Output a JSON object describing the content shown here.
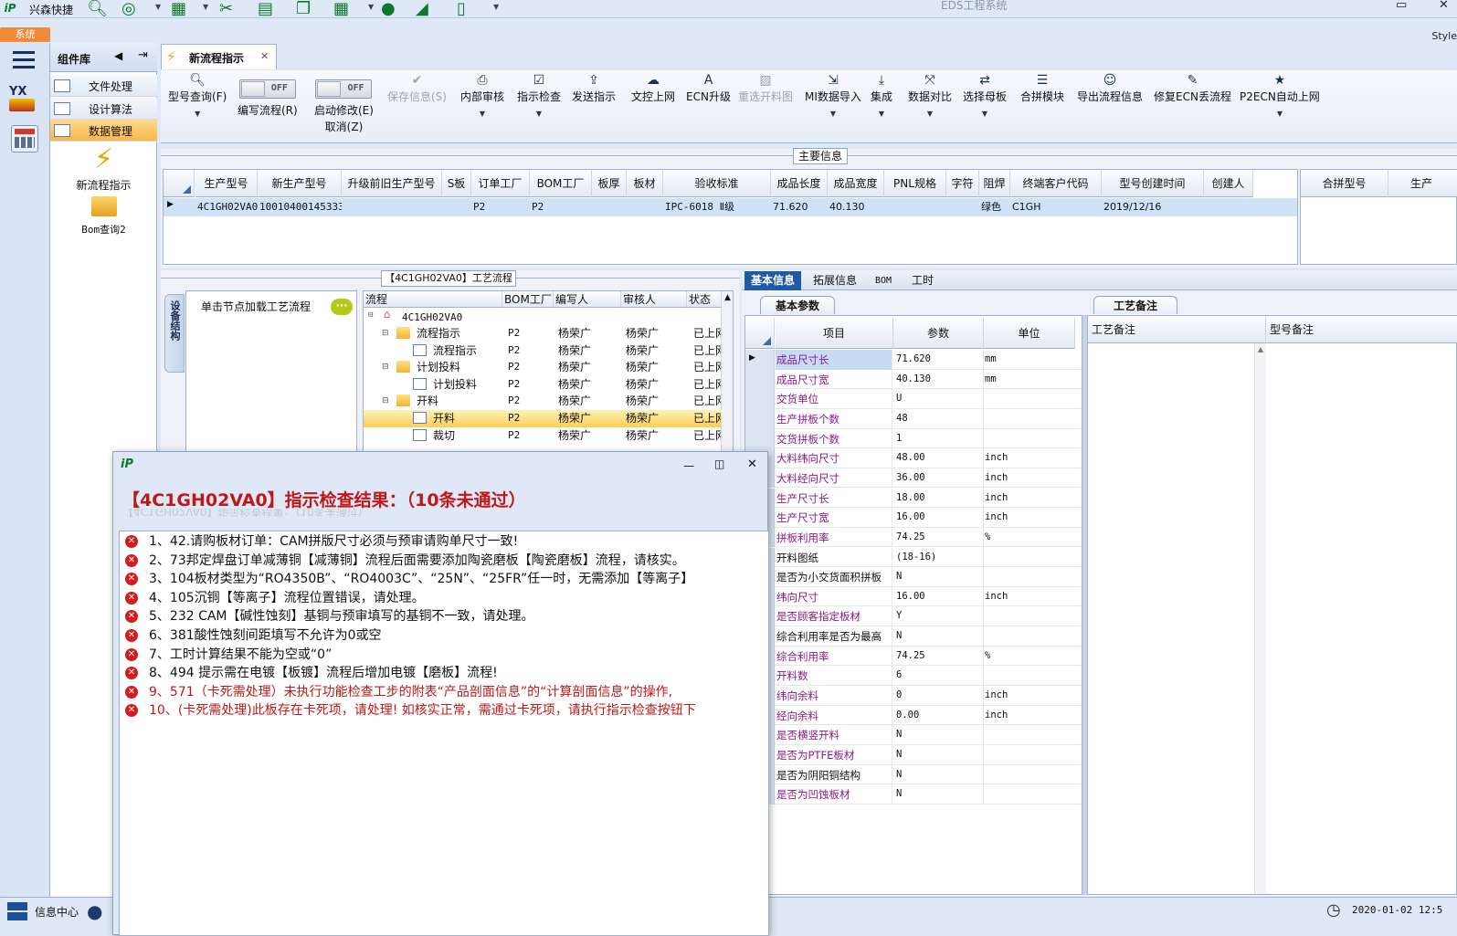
{
  "app": {
    "logo_text": "iP",
    "name": "兴森快捷",
    "title": "EDS工程系统",
    "minimize": "▭",
    "close": "✕",
    "system_tab": "系统",
    "style_label": "Style"
  },
  "quick_toolbar": [
    "search-icon",
    "lifebuoy-icon",
    "table-icon",
    "scissors-icon",
    "film-icon",
    "copy-icon",
    "grid-icon",
    "user-icon",
    "chart-icon",
    "tablet-icon"
  ],
  "component_library": {
    "title": "组件库",
    "items": [
      "文件处理",
      "设计算法",
      "数据管理"
    ],
    "selected": 2,
    "launchers": [
      "新流程指示",
      "Bom查询2"
    ]
  },
  "doc_tab": {
    "label": "新流程指示"
  },
  "ribbon": {
    "buttons": [
      {
        "label": "型号查询(F)",
        "icon": "search-icon",
        "dd": true
      },
      {
        "label": "编写流程(R)",
        "toggle": "OFF"
      },
      {
        "label": "启动修改(E)",
        "label2": "取消(Z)",
        "toggle": "OFF"
      },
      {
        "label": "保存信息(S)",
        "icon": "check-icon",
        "disabled": true
      },
      {
        "label": "内部审核",
        "icon": "print-icon",
        "dd": true
      },
      {
        "label": "指示检查",
        "icon": "checkbox-icon",
        "dd": true
      },
      {
        "label": "发送指示",
        "icon": "upload-icon"
      },
      {
        "label": "文控上网",
        "icon": "cloud-icon"
      },
      {
        "label": "ECN升级",
        "icon": "font-icon"
      },
      {
        "label": "重选开料图",
        "icon": "image-icon",
        "disabled": true
      },
      {
        "label": "MI数据导入",
        "icon": "import-icon",
        "dd": true
      },
      {
        "label": "集成",
        "icon": "download-icon",
        "dd": true
      },
      {
        "label": "数据对比",
        "icon": "compare-icon",
        "dd": true
      },
      {
        "label": "选择母板",
        "icon": "shuffle-icon",
        "dd": true
      },
      {
        "label": "合拼模块",
        "icon": "list-icon"
      },
      {
        "label": "导出流程信息",
        "icon": "smile-icon"
      },
      {
        "label": "修复ECN丢流程",
        "icon": "wrench-icon"
      },
      {
        "label": "P2ECN自动上网",
        "icon": "star-icon",
        "dd": true
      }
    ]
  },
  "main_info": {
    "title": "主要信息",
    "columns": [
      "生产型号",
      "新生产型号",
      "升级前旧生产型号",
      "S板",
      "订单工厂",
      "BOM工厂",
      "板厚",
      "板材",
      "验收标准",
      "成品长度",
      "成品宽度",
      "PNL规格",
      "字符",
      "阻焊",
      "终端客户代码",
      "型号创建时间",
      "创建人"
    ],
    "row": [
      "4C1GH02VA0",
      "10010400145333",
      "",
      "",
      "P2",
      "P2",
      "",
      "",
      "IPC-6018 Ⅱ级",
      "71.620",
      "40.130",
      "",
      "",
      "绿色",
      "C1GH",
      "2019/12/16",
      ""
    ],
    "right_columns": [
      "合拼型号",
      "生产"
    ]
  },
  "flow": {
    "title": "【4C1GH02VA0】工艺流程",
    "vtab": "设备结构",
    "load_hint": "单击节点加载工艺流程",
    "columns": [
      "流程",
      "BOM工厂",
      "编写人",
      "审核人",
      "状态"
    ],
    "root": "4C1GH02VA0",
    "rows": [
      {
        "name": "流程指示",
        "level": 1,
        "folder": true,
        "bom": "P2",
        "writer": "杨荣广",
        "reviewer": "杨荣广",
        "status": "已上网"
      },
      {
        "name": "流程指示",
        "level": 2,
        "folder": false,
        "bom": "P2",
        "writer": "杨荣广",
        "reviewer": "杨荣广",
        "status": "已上网"
      },
      {
        "name": "计划投料",
        "level": 1,
        "folder": true,
        "bom": "P2",
        "writer": "杨荣广",
        "reviewer": "杨荣广",
        "status": "已上网"
      },
      {
        "name": "计划投料",
        "level": 2,
        "folder": false,
        "bom": "P2",
        "writer": "杨荣广",
        "reviewer": "杨荣广",
        "status": "已上网"
      },
      {
        "name": "开料",
        "level": 1,
        "folder": true,
        "bom": "P2",
        "writer": "杨荣广",
        "reviewer": "杨荣广",
        "status": "已上网"
      },
      {
        "name": "开料",
        "level": 2,
        "folder": false,
        "bom": "P2",
        "writer": "杨荣广",
        "reviewer": "杨荣广",
        "status": "已上网",
        "selected": true
      },
      {
        "name": "裁切",
        "level": 2,
        "folder": false,
        "bom": "P2",
        "writer": "杨荣广",
        "reviewer": "杨荣广",
        "status": "已上网"
      }
    ]
  },
  "right_tabs": [
    "基本信息",
    "拓展信息",
    "BOM",
    "工时"
  ],
  "basic_params": {
    "tab": "基本参数",
    "columns": [
      "项目",
      "参数",
      "单位"
    ],
    "rows": [
      {
        "k": "成品尺寸长",
        "v": "71.620",
        "u": "mm",
        "c": "p"
      },
      {
        "k": "成品尺寸宽",
        "v": "40.130",
        "u": "mm",
        "c": "p"
      },
      {
        "k": "交货单位",
        "v": "U",
        "u": "",
        "c": "p"
      },
      {
        "k": "生产拼板个数",
        "v": "48",
        "u": "",
        "c": "p"
      },
      {
        "k": "交货拼板个数",
        "v": "1",
        "u": "",
        "c": "p"
      },
      {
        "k": "大料纬向尺寸",
        "v": "48.00",
        "u": "inch",
        "c": "p"
      },
      {
        "k": "大料经向尺寸",
        "v": "36.00",
        "u": "inch",
        "c": "p"
      },
      {
        "k": "生产尺寸长",
        "v": "18.00",
        "u": "inch",
        "c": "p"
      },
      {
        "k": "生产尺寸宽",
        "v": "16.00",
        "u": "inch",
        "c": "p"
      },
      {
        "k": "拼板利用率",
        "v": "74.25",
        "u": "%",
        "c": "p"
      },
      {
        "k": "开料图纸",
        "v": "(18-16)",
        "u": "",
        "c": "b"
      },
      {
        "k": "是否为小交货面积拼板",
        "v": "N",
        "u": "",
        "c": "b"
      },
      {
        "k": "纬向尺寸",
        "v": "16.00",
        "u": "inch",
        "c": "p"
      },
      {
        "k": "是否顾客指定板材",
        "v": "Y",
        "u": "",
        "c": "p"
      },
      {
        "k": "综合利用率是否为最高",
        "v": "N",
        "u": "",
        "c": "b"
      },
      {
        "k": "综合利用率",
        "v": "74.25",
        "u": "%",
        "c": "p"
      },
      {
        "k": "开料数",
        "v": "6",
        "u": "",
        "c": "p"
      },
      {
        "k": "纬向余料",
        "v": "0",
        "u": "inch",
        "c": "p"
      },
      {
        "k": "经向余料",
        "v": "0.00",
        "u": "inch",
        "c": "p"
      },
      {
        "k": "是否横竖开料",
        "v": "N",
        "u": "",
        "c": "p"
      },
      {
        "k": "是否为PTFE板材",
        "v": "N",
        "u": "",
        "c": "p"
      },
      {
        "k": "是否为阴阳铜结构",
        "v": "N",
        "u": "",
        "c": "b"
      },
      {
        "k": "是否为凹蚀板材",
        "v": "N",
        "u": "",
        "c": "p"
      }
    ]
  },
  "craft": {
    "tab": "工艺备注",
    "columns": [
      "工艺备注",
      "型号备注"
    ]
  },
  "dialog": {
    "logo": "iP",
    "title": "【4C1GH02VA0】指示检查结果：（10条未通过）",
    "ghost": "【4C1GH02VA0】指示检查结果：（10条未通过）",
    "items": [
      {
        "t": "1、42.请购板材订单：CAM拼版尺寸必须与预审请购单尺寸一致!",
        "red": false
      },
      {
        "t": "2、73邦定焊盘订单减薄铜【减薄铜】流程后面需要添加陶瓷磨板【陶瓷磨板】流程，请核实。",
        "red": false
      },
      {
        "t": "3、104板材类型为“RO4350B”、“RO4003C”、“25N”、“25FR”任一时，无需添加【等离子】",
        "red": false
      },
      {
        "t": "4、105沉铜【等离子】流程位置错误，请处理。",
        "red": false
      },
      {
        "t": "5、232 CAM【碱性蚀刻】基铜与预审填写的基铜不一致，请处理。",
        "red": false
      },
      {
        "t": "6、381酸性蚀刻间距填写不允许为0或空",
        "red": false
      },
      {
        "t": "7、工时计算结果不能为空或“0”",
        "red": false
      },
      {
        "t": "8、494 提示需在电镀【板镀】流程后增加电镀【磨板】流程!",
        "red": false
      },
      {
        "t": "9、571（卡死需处理）未执行功能检查工步的附表“产品剖面信息”的“计算剖面信息”的操作,",
        "red": true
      },
      {
        "t": "10、(卡死需处理)此板存在卡死项，请处理! 如核实正常，需通过卡死项，请执行指示检查按钮下",
        "red": true
      }
    ]
  },
  "status": {
    "info_center": "信息中心",
    "datetime": "2020-01-02 12:5"
  },
  "colors": {
    "accent": "#1e5aa8",
    "error": "#c01818",
    "purple": "#8a1a86",
    "orange": "#f08a3a"
  }
}
